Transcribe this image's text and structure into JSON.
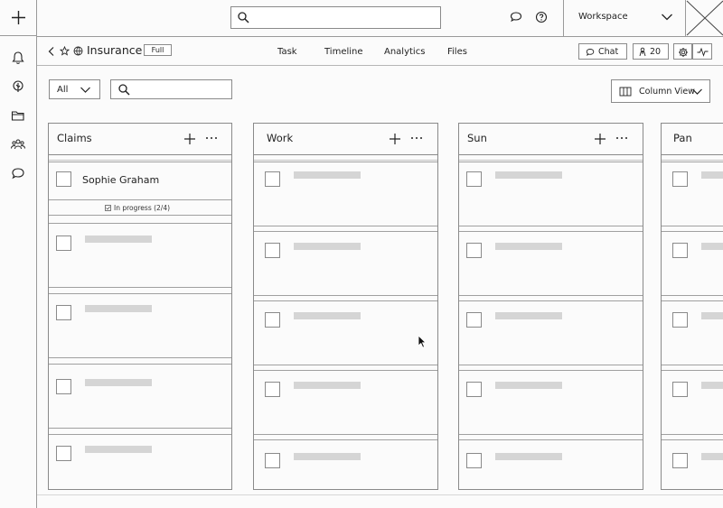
{
  "app": {
    "title": "Insurance",
    "badge": "Full",
    "workspace": "Workspace"
  },
  "tabs": [
    {
      "label": "Task"
    },
    {
      "label": "Timeline"
    },
    {
      "label": "Analytics"
    },
    {
      "label": "Files"
    }
  ],
  "toolbar": {
    "chat_label": "Chat",
    "member_count": "20"
  },
  "filters": {
    "select_value": "All",
    "view_label": "Column View"
  },
  "columns": [
    {
      "title": "Claims",
      "cards": [
        {
          "name": "Sophie Graham",
          "status": "In progress (2/4)"
        }
      ]
    },
    {
      "title": "Work"
    },
    {
      "title": "Sun"
    },
    {
      "title": "Pan"
    }
  ]
}
